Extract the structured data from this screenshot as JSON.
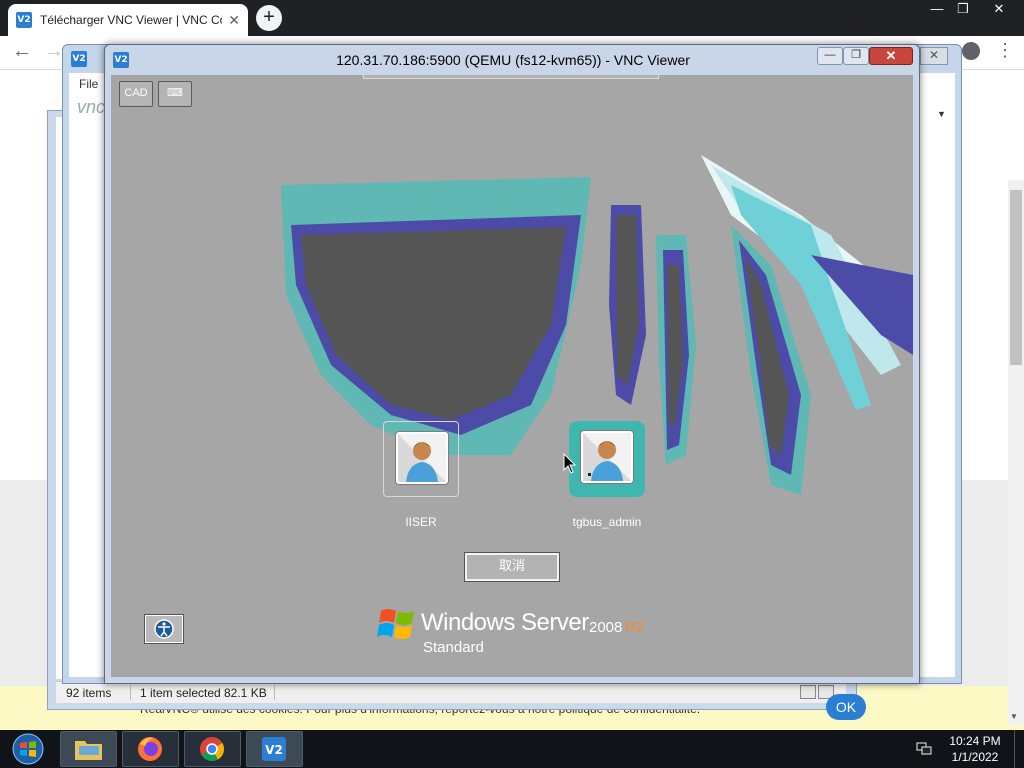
{
  "browser": {
    "tab_title": "Télécharger VNC Viewer | VNC Connect",
    "tab_close": "✕",
    "new_tab": "+",
    "back": "←",
    "forward": "→",
    "menu": "⋮",
    "window_controls": {
      "minimize": "—",
      "restore": "❐",
      "close": "✕"
    }
  },
  "cookie_banner": {
    "text": "RealVNC® utilise des cookies. Pour plus d'informations, reportez-vous à notre politique de confidentialité.",
    "ok_label": "OK"
  },
  "explorer": {
    "status_items": "92 items",
    "status_selected": "1 item selected",
    "status_size": "82.1 KB"
  },
  "vnc_background": {
    "menu_file": "File",
    "brand": "vnc",
    "close": "✕",
    "dropdown": "▼"
  },
  "vnc_window": {
    "title": "120.31.70.186:5900 (QEMU (fs12-kvm65)) - VNC Viewer",
    "min": "—",
    "max": "❐",
    "close": "✕",
    "toolbar_ctrl_alt_del": "CAD",
    "toolbar_keyboard": "⌨"
  },
  "remote_screen": {
    "users": [
      {
        "name": "IISER",
        "state": "normal"
      },
      {
        "name": "tgbus_admin",
        "state": "hover"
      }
    ],
    "cancel_label": "取消",
    "os_brand": "Windows Server",
    "os_version": "2008",
    "os_release": "R2",
    "os_edition": "Standard"
  },
  "taskbar": {
    "apps": [
      "start-orb",
      "file-explorer",
      "firefox",
      "chrome",
      "vnc-viewer"
    ],
    "clock_time": "10:24 PM",
    "clock_date": "1/1/2022"
  },
  "colors": {
    "login_background": "#a6a6a6",
    "selected_tile": "#3fb7b0",
    "window_close": "#c9463d",
    "brand_orange": "#f28b2c",
    "vnc_blue": "#2a7fd4"
  }
}
